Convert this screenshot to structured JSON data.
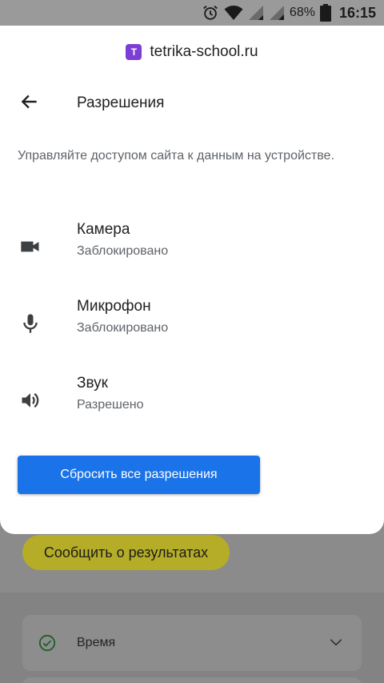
{
  "status_bar": {
    "battery_percent": "68%",
    "time": "16:15",
    "icons": [
      "alarm-icon",
      "wifi-icon",
      "signal-icon",
      "signal-icon",
      "battery-icon"
    ]
  },
  "site": {
    "favicon_text": "T",
    "domain": "tetrika-school.ru",
    "favicon_color": "#7b3fd6"
  },
  "header": {
    "back_icon": "arrow-left-icon",
    "title": "Разрешения"
  },
  "description": "Управляйте доступом сайта к данным на устройстве.",
  "permissions": [
    {
      "icon": "camera-icon",
      "name": "Камера",
      "status": "Заблокировано"
    },
    {
      "icon": "microphone-icon",
      "name": "Микрофон",
      "status": "Заблокировано"
    },
    {
      "icon": "speaker-icon",
      "name": "Звук",
      "status": "Разрешено"
    }
  ],
  "reset_button": {
    "label": "Сбросить все разрешения",
    "color": "#1a73e8"
  },
  "background_page": {
    "report_button": "Сообщить о результатах",
    "report_button_color": "#b5ad27",
    "card_label": "Время",
    "card_icon": "check-circle-icon",
    "card_chevron": "chevron-down-icon"
  }
}
